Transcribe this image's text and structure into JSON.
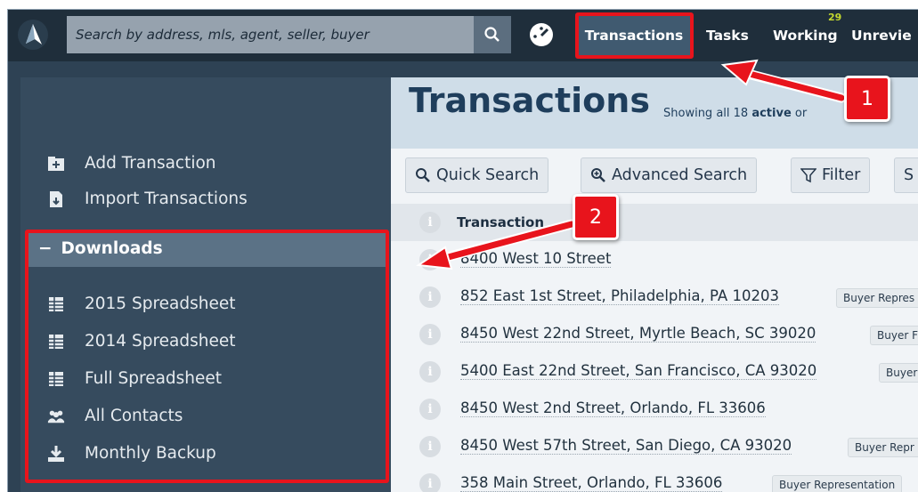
{
  "header": {
    "search_placeholder": "Search by address, mls, agent, seller, buyer",
    "nav": {
      "transactions": "Transactions",
      "tasks": "Tasks",
      "working": "Working",
      "working_badge": "29",
      "unreviewed": "Unrevie"
    }
  },
  "sidebar": {
    "add_transaction": "Add Transaction",
    "import_transactions": "Import Transactions",
    "downloads_header": "Downloads",
    "downloads_collapse": "−",
    "downloads": [
      "2015 Spreadsheet",
      "2014 Spreadsheet",
      "Full Spreadsheet",
      "All Contacts",
      "Monthly Backup"
    ]
  },
  "main": {
    "title": "Transactions",
    "subtitle_prefix": "Showing all 18",
    "subtitle_bold": "active",
    "subtitle_rest": "or",
    "toolbar": {
      "quick_search": "Quick Search",
      "advanced_search": "Advanced Search",
      "filter": "Filter",
      "more": "S"
    },
    "table_header": "Transaction",
    "info_glyph": "i",
    "rows": [
      {
        "address": "8400 West 10 Street",
        "tag": ""
      },
      {
        "address": "852 East 1st Street, Philadelphia, PA 10203",
        "tag": "Buyer Repres"
      },
      {
        "address": "8450 West 22nd Street, Myrtle Beach, SC 39020",
        "tag": "Buyer F"
      },
      {
        "address": "5400 East 22nd Street, San Francisco, CA 93020",
        "tag": "Buyer"
      },
      {
        "address": "8450 West 2nd Street, Orlando, FL 33606",
        "tag": ""
      },
      {
        "address": "8450 West 57th Street, San Diego, CA 93020",
        "tag": "Buyer Repr"
      },
      {
        "address": "358 Main Street, Orlando, FL 33606",
        "tag": "Buyer Representation"
      }
    ]
  },
  "callouts": {
    "one": "1",
    "two": "2"
  },
  "colors": {
    "accent_red": "#e8141c",
    "topbar": "#1f2e3b",
    "sidebar": "#364b5e",
    "title": "#1f3e5c"
  }
}
